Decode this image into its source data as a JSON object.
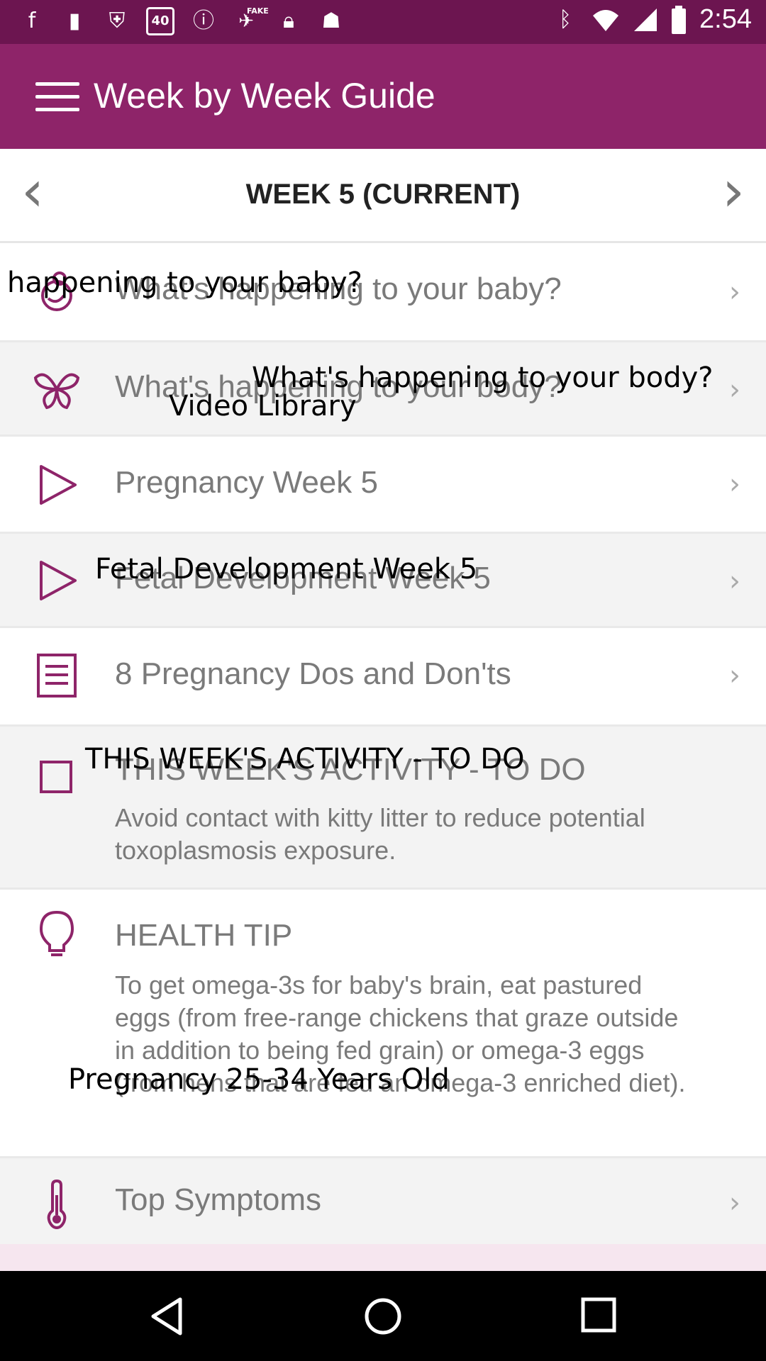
{
  "status_bar": {
    "time": "2:54",
    "left_icons": [
      "facebook-icon",
      "flipboard-icon",
      "shield-icon",
      "badge-40-icon",
      "info-icon",
      "satellite-icon",
      "lock-icon",
      "robot-icon"
    ],
    "badge_text": "40",
    "fake_label": "FAKE",
    "right_icons": [
      "bluetooth-icon",
      "wifi-icon",
      "signal-icon",
      "battery-icon"
    ]
  },
  "app_bar": {
    "title": "Week by Week Guide"
  },
  "week_nav": {
    "title": "WEEK 5 (CURRENT)",
    "prev": "‹",
    "next": "›"
  },
  "rows": [
    {
      "label": "What's happening to your baby?",
      "icon": "baby-icon"
    },
    {
      "label": "What's happening to your body?",
      "icon": "butterfly-icon"
    },
    {
      "label": "Pregnancy Week 5",
      "icon": "play-icon"
    },
    {
      "label": "Fetal Development Week 5",
      "icon": "play-icon"
    },
    {
      "label": "8 Pregnancy Dos and Don'ts",
      "icon": "document-icon"
    },
    {
      "label": "THIS WEEK'S ACTIVITY - TO DO",
      "body": "Avoid contact with kitty litter to reduce potential toxoplasmosis exposure.",
      "icon": "checkbox-icon"
    },
    {
      "label": "HEALTH TIP",
      "body": "To get omega-3s for baby's brain, eat pastured eggs (from free-range chickens that graze outside in addition to being fed grain) or omega-3 eggs (from hens that are fed an omega-3 enriched diet).",
      "icon": "lightbulb-icon"
    },
    {
      "label": "Top Symptoms",
      "icon": "thermometer-icon"
    }
  ],
  "overlay_labels": {
    "baby": "happening to your baby?",
    "body": "What's happening to your body?",
    "video": "Video Library",
    "fetal": "Fetal Development Week 5",
    "activity": "THIS WEEK'S ACTIVITY - TO DO",
    "pregnancy_age": "Pregnancy 25-34 Years Old"
  },
  "chevron": "›",
  "colors": {
    "status_bar": "#6c1550",
    "app_bar": "#8e2469",
    "accent": "#8e2469"
  }
}
